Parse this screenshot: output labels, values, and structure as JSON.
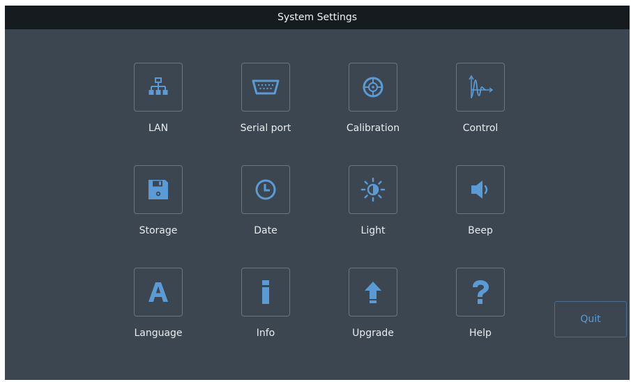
{
  "header": {
    "title": "System Settings"
  },
  "colors": {
    "background": "#3c4650",
    "titlebar": "#161b20",
    "icon_accent": "#5b9bd5",
    "tile_border": "#6b7682",
    "label_text": "#e8ecef"
  },
  "tiles": [
    {
      "label": "LAN",
      "icon": "network-icon"
    },
    {
      "label": "Serial port",
      "icon": "serial-port-icon"
    },
    {
      "label": "Calibration",
      "icon": "calibration-icon"
    },
    {
      "label": "Control",
      "icon": "control-curve-icon"
    },
    {
      "label": "Storage",
      "icon": "floppy-disk-icon"
    },
    {
      "label": "Date",
      "icon": "clock-icon"
    },
    {
      "label": "Light",
      "icon": "brightness-icon"
    },
    {
      "label": "Beep",
      "icon": "speaker-icon"
    },
    {
      "label": "Language",
      "icon": "letter-a-icon"
    },
    {
      "label": "Info",
      "icon": "info-icon"
    },
    {
      "label": "Upgrade",
      "icon": "up-arrow-icon"
    },
    {
      "label": "Help",
      "icon": "question-mark-icon"
    }
  ],
  "quit": {
    "label": "Quit"
  }
}
